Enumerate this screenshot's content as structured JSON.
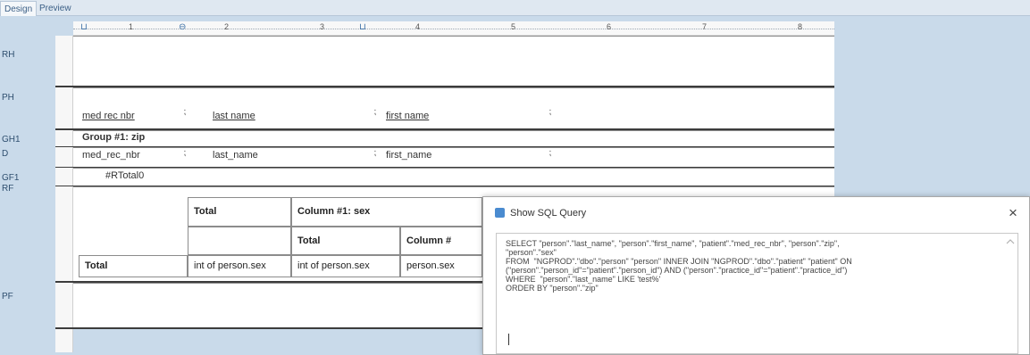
{
  "tabs": {
    "design": "Design",
    "preview": "Preview"
  },
  "bands": {
    "rh": "RH",
    "ph": "PH",
    "gh1": "GH1",
    "d": "D",
    "gf1": "GF1",
    "rf": "RF",
    "pf": "PF"
  },
  "ruler": {
    "numbers": [
      "1",
      "2",
      "3",
      "4",
      "5",
      "6",
      "7",
      "8"
    ]
  },
  "page_header_fields": {
    "med_rec_nbr": "med rec nbr",
    "last_name": "last name",
    "first_name": "first name"
  },
  "group_header": {
    "label": "Group #1: zip"
  },
  "detail_fields": {
    "med_rec_nbr": "med_rec_nbr",
    "last_name": "last_name",
    "first_name": "first_name"
  },
  "group_footer": {
    "total_field": "#RTotal0"
  },
  "crosstab": {
    "total_header": "Total",
    "column_header": "Column #1: sex",
    "sub_total": "Total",
    "sub_column": "Column #",
    "row_total_label": "Total",
    "cells": [
      "int of person.sex",
      "int of person.sex",
      "person.sex"
    ]
  },
  "dialog": {
    "title": "Show SQL Query",
    "close_glyph": "×",
    "sql": "SELECT \"person\".\"last_name\", \"person\".\"first_name\", \"patient\".\"med_rec_nbr\", \"person\".\"zip\",\n\"person\".\"sex\"\nFROM  \"NGPROD\".\"dbo\".\"person\" \"person\" INNER JOIN \"NGPROD\".\"dbo\".\"patient\" \"patient\" ON\n(\"person\".\"person_id\"=\"patient\".\"person_id\") AND (\"person\".\"practice_id\"=\"patient\".\"practice_id\")\nWHERE  \"person\".\"last_name\" LIKE 'test%'\nORDER BY \"person\".\"zip\""
  },
  "colors": {
    "background": "#c9daea",
    "accent": "#4a8bd0"
  }
}
